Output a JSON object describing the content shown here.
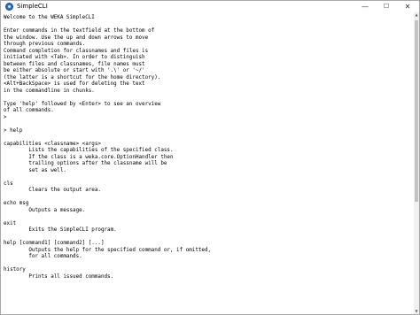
{
  "window": {
    "title": "SimpleCLI",
    "app_icon": "weka-bird-icon",
    "controls": {
      "minimize": "—",
      "maximize": "☐",
      "close": "✕"
    }
  },
  "console": {
    "text": "Welcome to the WEKA SimpleCLI\n\nEnter commands in the textfield at the bottom of\nthe window. Use the up and down arrows to move\nthrough previous commands.\nCommand completion for classnames and files is\ninitiated with <Tab>. In order to distinguish\nbetween files and classnames, file names must\nbe either absolute or start with '.\\' or '~/'\n(the latter is a shortcut for the home directory).\n<Alt+BackSpace> is used for deleting the text\nin the commandline in chunks.\n\nType 'help' followed by <Enter> to see an overview\nof all commands.\n>\n\n> help\n\ncapabilities <classname> <args>\n        Lists the capabilities of the specified class.\n        If the class is a weka.core.OptionHandler then\n        trailing options after the classname will be\n        set as well.\n\ncls\n        Clears the output area.\n\necho msg\n        Outputs a message.\n\nexit\n        Exits the SimpleCLI program.\n\nhelp [command1] [command2] [...]\n        Outputs the help for the specified command or, if omitted,\n        for all commands.\n\nhistory\n        Prints all issued commands."
  },
  "scrollbar": {
    "up_arrow": "▲",
    "down_arrow": "▼",
    "position_fraction": 0
  }
}
